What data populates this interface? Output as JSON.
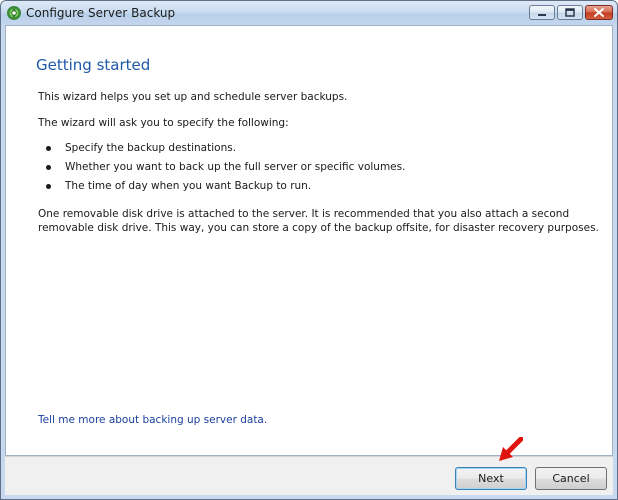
{
  "window": {
    "title": "Configure Server Backup"
  },
  "content": {
    "heading": "Getting started",
    "intro": "This wizard helps you set up and schedule server backups.",
    "ask": "The wizard will ask you to specify the following:",
    "bullets": [
      "Specify the backup destinations.",
      "Whether you want to back up the full server or specific volumes.",
      "The time of day when you want Backup to run."
    ],
    "note_line1": "One removable disk drive is attached to the server. It is recommended that you also attach a second",
    "note_line2": "removable disk drive. This way, you can store a copy of the backup offsite, for disaster recovery purposes.",
    "help_link": "Tell me more about backing up server data."
  },
  "buttons": {
    "next": "Next",
    "cancel": "Cancel"
  },
  "icons": {
    "app": "server-backup-icon",
    "minimize": "minimize-icon",
    "maximize": "maximize-icon",
    "close": "close-icon",
    "pointer": "red-arrow-icon"
  },
  "colors": {
    "heading": "#1e5aa8",
    "link": "#1a3f9c",
    "close_button": "#c23a1f",
    "pointer_arrow": "#e0140f"
  }
}
